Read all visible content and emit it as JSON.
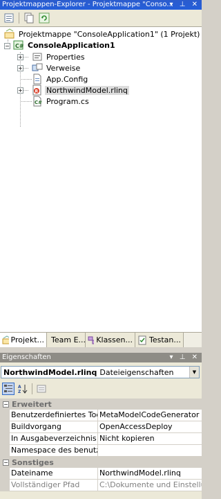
{
  "solution_explorer": {
    "title": "Projektmappen-Explorer - Projektmappe \"Conso...",
    "title_controls": "▾ ⊥ ✕",
    "tree": {
      "solution": "Projektmappe \"ConsoleApplication1\" (1 Projekt)",
      "project": "ConsoleApplication1",
      "items": [
        {
          "label": "Properties",
          "icon": "properties-icon"
        },
        {
          "label": "Verweise",
          "icon": "references-icon"
        },
        {
          "label": "App.Config",
          "icon": "config-file-icon"
        },
        {
          "label": "NorthwindModel.rlinq",
          "icon": "rlinq-file-icon"
        },
        {
          "label": "Program.cs",
          "icon": "csharp-file-icon"
        }
      ]
    }
  },
  "tabs": [
    {
      "label": "Projekt...",
      "icon": "solution-explorer-icon"
    },
    {
      "label": "Team E...",
      "icon": "team-explorer-icon"
    },
    {
      "label": "Klassen...",
      "icon": "class-view-icon"
    },
    {
      "label": "Testan...",
      "icon": "test-view-icon"
    }
  ],
  "properties": {
    "title": "Eigenschaften",
    "title_controls": "▾ ⊥ ✕",
    "object_name": "NorthwindModel.rlinq",
    "object_type": "Dateieigenschaften",
    "categories": [
      {
        "name": "Erweitert",
        "rows": [
          {
            "key": "Benutzerdefiniertes Tool",
            "value": "MetaModelCodeGenerator"
          },
          {
            "key": "Buildvorgang",
            "value": "OpenAccessDeploy"
          },
          {
            "key": "In Ausgabeverzeichnis ko",
            "value": "Nicht kopieren"
          },
          {
            "key": "Namespace des benutzerd",
            "value": ""
          }
        ]
      },
      {
        "name": "Sonstiges",
        "rows": [
          {
            "key": "Dateiname",
            "value": "NorthwindModel.rlinq"
          },
          {
            "key": "Vollständiger Pfad",
            "value": "C:\\Dokumente und Einstellunge"
          }
        ]
      }
    ]
  },
  "colors": {
    "title_active": "#245edb",
    "title_inactive": "#8e8c86",
    "selection": "#dcdcdc",
    "chrome": "#ece9d8"
  }
}
